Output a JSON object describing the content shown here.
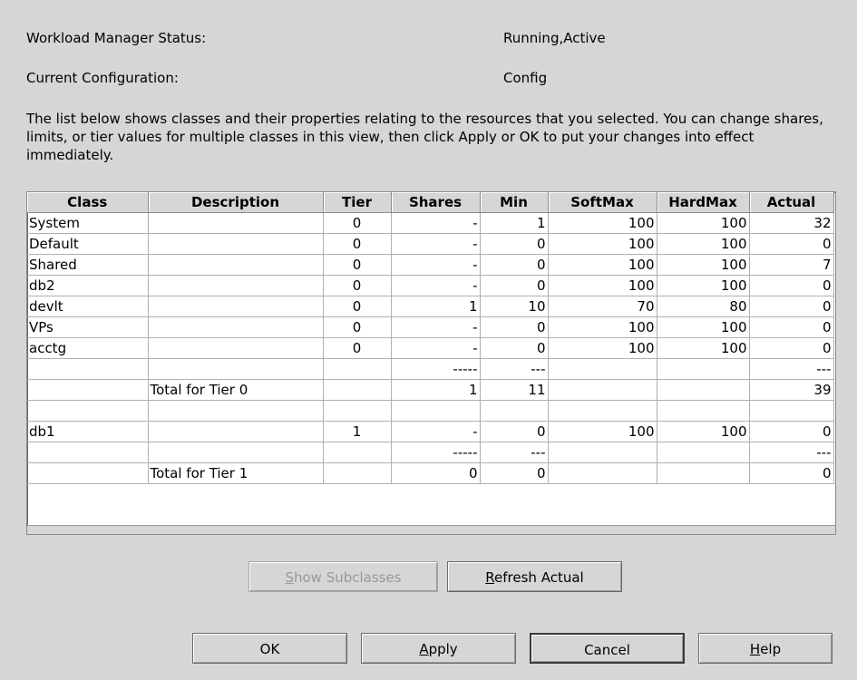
{
  "status": {
    "wlm_label": "Workload Manager Status:",
    "wlm_value": "Running,Active",
    "config_label": "Current Configuration:",
    "config_value": "Config"
  },
  "description": "The list below shows classes and their properties relating to the resources that you selected. You can change shares, limits, or tier values for multiple classes in this view, then click Apply or OK to put your changes into effect immediately.",
  "table": {
    "columns": [
      "Class",
      "Description",
      "Tier",
      "Shares",
      "Min",
      "SoftMax",
      "HardMax",
      "Actual"
    ],
    "rows": [
      [
        "System",
        "",
        "0",
        "-",
        "1",
        "100",
        "100",
        "32"
      ],
      [
        "Default",
        "",
        "0",
        "-",
        "0",
        "100",
        "100",
        "0"
      ],
      [
        "Shared",
        "",
        "0",
        "-",
        "0",
        "100",
        "100",
        "7"
      ],
      [
        "db2",
        "",
        "0",
        "-",
        "0",
        "100",
        "100",
        "0"
      ],
      [
        "devlt",
        "",
        "0",
        "1",
        "10",
        "70",
        "80",
        "0"
      ],
      [
        "VPs",
        "",
        "0",
        "-",
        "0",
        "100",
        "100",
        "0"
      ],
      [
        "acctg",
        "",
        "0",
        "-",
        "0",
        "100",
        "100",
        "0"
      ],
      [
        "",
        "",
        "",
        "-----",
        "---",
        "",
        "",
        "---"
      ],
      [
        "",
        "Total for Tier 0",
        "",
        "1",
        "11",
        "",
        "",
        "39"
      ],
      [
        "",
        "",
        "",
        "",
        "",
        "",
        "",
        ""
      ],
      [
        "db1",
        "",
        "1",
        "-",
        "0",
        "100",
        "100",
        "0"
      ],
      [
        "",
        "",
        "",
        "-----",
        "---",
        "",
        "",
        "---"
      ],
      [
        "",
        "Total for Tier 1",
        "",
        "0",
        "0",
        "",
        "",
        "0"
      ]
    ]
  },
  "buttons": {
    "show_subclasses": {
      "pre": "",
      "ul": "S",
      "post": "how Subclasses"
    },
    "refresh_actual": {
      "pre": "",
      "ul": "R",
      "post": "efresh Actual"
    },
    "ok": {
      "pre": "OK",
      "ul": "",
      "post": ""
    },
    "apply": {
      "pre": "",
      "ul": "A",
      "post": "pply"
    },
    "cancel": {
      "pre": "Cancel",
      "ul": "",
      "post": ""
    },
    "help": {
      "pre": "",
      "ul": "H",
      "post": "elp"
    }
  }
}
